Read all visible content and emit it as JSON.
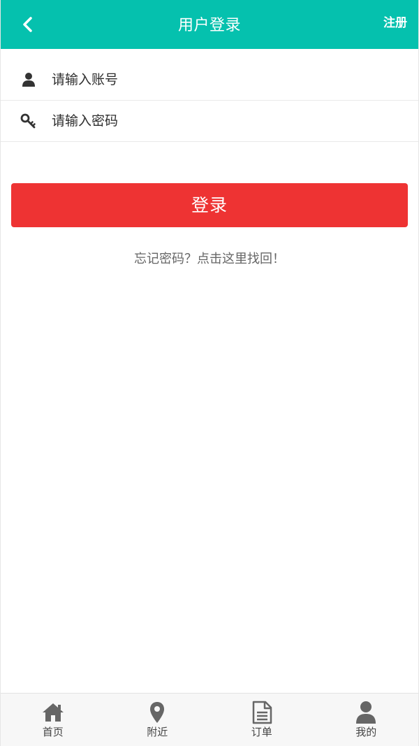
{
  "header": {
    "title": "用户登录",
    "register_label": "注册",
    "back_icon": "chevron-left-icon",
    "background": "#05c1ae"
  },
  "form": {
    "account": {
      "placeholder": "请输入账号",
      "value": "",
      "icon": "user-icon"
    },
    "password": {
      "placeholder": "请输入密码",
      "value": "",
      "icon": "key-icon"
    }
  },
  "login_button": {
    "label": "登录",
    "color": "#ee3333"
  },
  "forgot_link": "忘记密码？点击这里找回！",
  "tabbar": {
    "items": [
      {
        "label": "首页",
        "icon": "home-icon"
      },
      {
        "label": "附近",
        "icon": "location-pin-icon"
      },
      {
        "label": "订单",
        "icon": "document-icon"
      },
      {
        "label": "我的",
        "icon": "user-icon"
      }
    ]
  }
}
